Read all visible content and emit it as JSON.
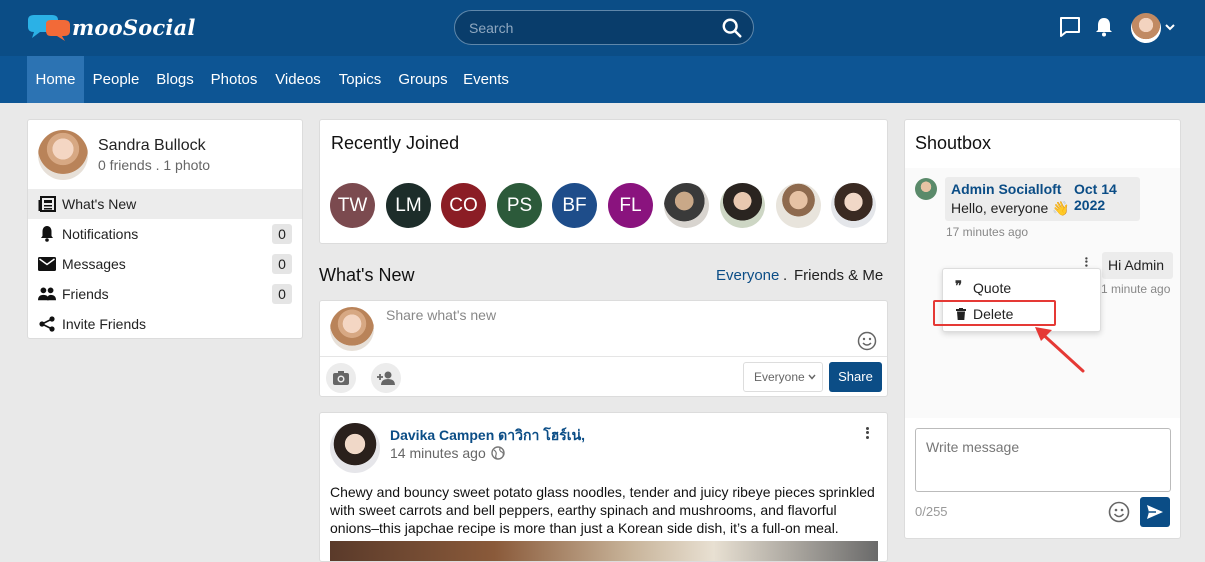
{
  "app": {
    "name": "mooSocial"
  },
  "header": {
    "search_placeholder": "Search",
    "icons": [
      "search-icon",
      "chat-icon",
      "bell-icon",
      "avatar",
      "chevron-down-icon"
    ]
  },
  "nav": {
    "items": [
      {
        "label": "Home",
        "active": true
      },
      {
        "label": "People"
      },
      {
        "label": "Blogs"
      },
      {
        "label": "Photos"
      },
      {
        "label": "Videos"
      },
      {
        "label": "Topics"
      },
      {
        "label": "Groups"
      },
      {
        "label": "Events"
      }
    ]
  },
  "profile": {
    "name": "Sandra Bullock",
    "stats": "0 friends . 1 photo",
    "menu": [
      {
        "label": "What's New",
        "icon": "newspaper-icon",
        "active": true
      },
      {
        "label": "Notifications",
        "icon": "bell-icon",
        "count": "0"
      },
      {
        "label": "Messages",
        "icon": "envelope-icon",
        "count": "0"
      },
      {
        "label": "Friends",
        "icon": "people-icon",
        "count": "0"
      },
      {
        "label": "Invite Friends",
        "icon": "share-icon"
      }
    ]
  },
  "recently_joined": {
    "title": "Recently Joined",
    "members": [
      {
        "initials": "TW",
        "color": "#7b4a4f"
      },
      {
        "initials": "LM",
        "color": "#1d2d2a"
      },
      {
        "initials": "CO",
        "color": "#8b1d25"
      },
      {
        "initials": "PS",
        "color": "#2c5a3a"
      },
      {
        "initials": "BF",
        "color": "#1e4d8a"
      },
      {
        "initials": "FL",
        "color": "#8a137e"
      }
    ]
  },
  "whats_new": {
    "title": "What's New",
    "filters": [
      "Everyone",
      "Friends & Me"
    ],
    "filter_sep": ".",
    "composer_placeholder": "Share what's new",
    "privacy": "Everyone",
    "share_label": "Share"
  },
  "post": {
    "author": "Davika Campen ดาวิกา โฮร์เน่,",
    "time": "14 minutes ago",
    "body": "Chewy and bouncy sweet potato glass noodles, tender and juicy ribeye pieces sprinkled with sweet carrots and bell peppers, earthy spinach and mushrooms, and flavorful onions–this japchae recipe is more than just a Korean side dish, it’s a full-on meal."
  },
  "shoutbox": {
    "title": "Shoutbox",
    "message1": {
      "author": "Admin Socialloft",
      "date": "Oct 14 2022",
      "text": "Hello, everyone 👋",
      "time": "17 minutes ago"
    },
    "message2": {
      "text": "Hi Admin",
      "time": "1 minute ago"
    },
    "context_menu": {
      "quote": "Quote",
      "delete": "Delete"
    },
    "input_placeholder": "Write message",
    "char_count": "0/255"
  },
  "colors": {
    "brand": "#0b4d86",
    "nav": "#0d5594",
    "nav_active": "#2c73b3",
    "highlight": "#e53935"
  }
}
